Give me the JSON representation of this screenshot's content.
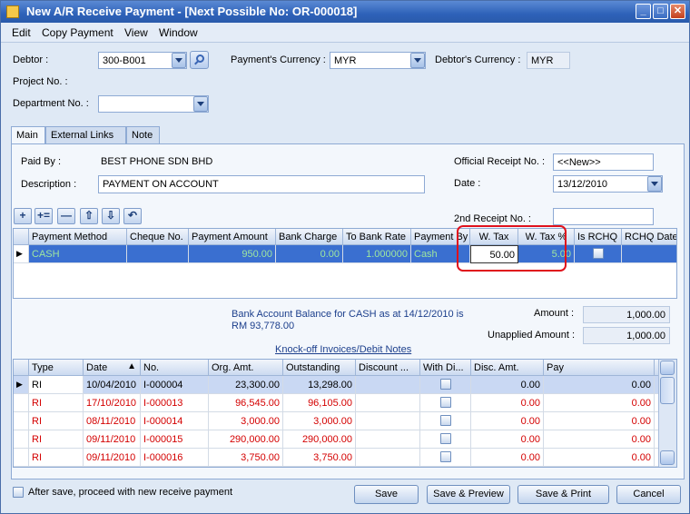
{
  "window": {
    "title": "New A/R Receive Payment - [Next Possible No: OR-000018]",
    "min": "_",
    "max": "□",
    "close": "✕"
  },
  "menu": [
    "Edit",
    "Copy Payment",
    "View",
    "Window"
  ],
  "header": {
    "debtor_label": "Debtor :",
    "debtor_value": "300-B001",
    "project_label": "Project No. :",
    "department_label": "Department No. :",
    "department_value": "",
    "payment_currency_label": "Payment's Currency :",
    "payment_currency_value": "MYR",
    "debtor_currency_label": "Debtor's Currency :",
    "debtor_currency_value": "MYR"
  },
  "tabs": [
    "Main",
    "External Links",
    "Note"
  ],
  "main": {
    "paid_by_label": "Paid By :",
    "paid_by_value": "BEST PHONE SDN BHD",
    "description_label": "Description :",
    "description_value": "PAYMENT ON ACCOUNT",
    "official_receipt_label": "Official Receipt No. :",
    "official_receipt_value": "<<New>>",
    "date_label": "Date :",
    "date_value": "13/12/2010",
    "second_receipt_label": "2nd Receipt No. :",
    "second_receipt_value": ""
  },
  "toolbar": [
    "+",
    "+=",
    "—",
    "⇧",
    "⇩",
    "↶"
  ],
  "payment_grid": {
    "columns": [
      "Payment Method",
      "Cheque No.",
      "Payment Amount",
      "Bank Charge",
      "To Bank Rate",
      "Payment By",
      "W. Tax",
      "W. Tax %",
      "Is RCHQ",
      "RCHQ Date"
    ],
    "rows": [
      {
        "method": "CASH",
        "cheque": "",
        "amount": "950.00",
        "bank_charge": "0.00",
        "rate": "1.000000",
        "payment_by": "Cash",
        "wtax": "50.00",
        "wtax_pct": "5.00",
        "rchq_date": ""
      }
    ]
  },
  "balance": {
    "text": "Bank Account Balance for CASH as at 14/12/2010 is RM 93,778.00",
    "amount_label": "Amount :",
    "amount_value": "1,000.00",
    "unapplied_label": "Unapplied Amount :",
    "unapplied_value": "1,000.00"
  },
  "knockoff": {
    "title": "Knock-off Invoices/Debit Notes",
    "columns": [
      "Type",
      "Date",
      "No.",
      "Org. Amt.",
      "Outstanding",
      "Discount ...",
      "With Di...",
      "Disc. Amt.",
      "Pay"
    ],
    "rows": [
      {
        "type": "RI",
        "date": "10/04/2010",
        "no": "I-000004",
        "org": "23,300.00",
        "outstanding": "13,298.00",
        "disc_amt": "0.00",
        "pay": "0.00"
      },
      {
        "type": "RI",
        "date": "17/10/2010",
        "no": "I-000013",
        "org": "96,545.00",
        "outstanding": "96,105.00",
        "disc_amt": "0.00",
        "pay": "0.00"
      },
      {
        "type": "RI",
        "date": "08/11/2010",
        "no": "I-000014",
        "org": "3,000.00",
        "outstanding": "3,000.00",
        "disc_amt": "0.00",
        "pay": "0.00"
      },
      {
        "type": "RI",
        "date": "09/11/2010",
        "no": "I-000015",
        "org": "290,000.00",
        "outstanding": "290,000.00",
        "disc_amt": "0.00",
        "pay": "0.00"
      },
      {
        "type": "RI",
        "date": "09/11/2010",
        "no": "I-000016",
        "org": "3,750.00",
        "outstanding": "3,750.00",
        "disc_amt": "0.00",
        "pay": "0.00"
      }
    ]
  },
  "footer": {
    "after_save_label": "After save, proceed with new receive payment",
    "save": "Save",
    "save_preview": "Save & Preview",
    "save_print": "Save & Print",
    "cancel": "Cancel"
  },
  "colors": {
    "selected_row": "#3a6fd0",
    "red_text": "#d40000",
    "green_text": "#2f8a2f"
  }
}
